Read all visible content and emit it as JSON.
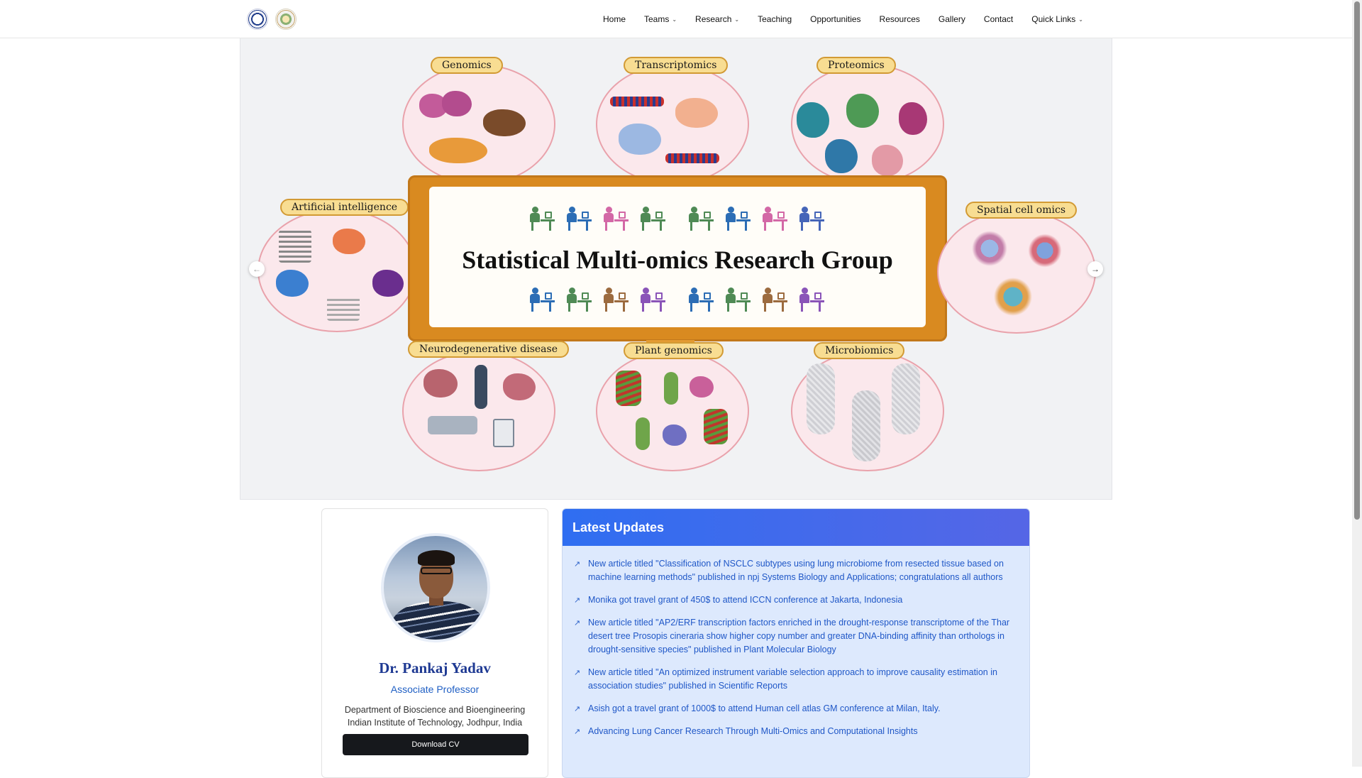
{
  "nav": {
    "items": [
      {
        "label": "Home",
        "dropdown": false
      },
      {
        "label": "Teams",
        "dropdown": true
      },
      {
        "label": "Research",
        "dropdown": true
      },
      {
        "label": "Teaching",
        "dropdown": false
      },
      {
        "label": "Opportunities",
        "dropdown": false
      },
      {
        "label": "Resources",
        "dropdown": false
      },
      {
        "label": "Gallery",
        "dropdown": false
      },
      {
        "label": "Contact",
        "dropdown": false
      },
      {
        "label": "Quick Links",
        "dropdown": true
      }
    ]
  },
  "hero": {
    "title": "Statistical Multi-omics Research Group",
    "topics": {
      "genomics": "Genomics",
      "transcriptomics": "Transcriptomics",
      "proteomics": "Proteomics",
      "ai": "Artificial intelligence",
      "spatial": "Spatial cell omics",
      "neuro": "Neurodegenerative disease",
      "plant": "Plant genomics",
      "microbiomics": "Microbiomics"
    },
    "worker_colors_top": [
      "#4f8a55",
      "#2c6db5",
      "#d368a6",
      "#4f8a55",
      "#4f8a55",
      "#2c6db5",
      "#d368a6",
      "#4565b8"
    ],
    "worker_colors_bottom": [
      "#2c6db5",
      "#4f8a55",
      "#9c6b3f",
      "#8a54b8",
      "#2c6db5",
      "#4f8a55",
      "#9c6b3f",
      "#8a54b8"
    ]
  },
  "profile": {
    "name": "Dr. Pankaj Yadav",
    "role": "Associate Professor",
    "department": "Department of Bioscience and Bioengineering",
    "institute": "Indian Institute of Technology, Jodhpur, India",
    "cv_label": "Download CV"
  },
  "updates": {
    "heading": "Latest Updates",
    "items": [
      "New article titled \"Classification of NSCLC subtypes using lung microbiome from resected tissue based on machine learning methods\" published in npj Systems Biology and Applications; congratulations all authors",
      "Monika got travel grant of 450$ to attend ICCN conference at Jakarta, Indonesia",
      "New article titled \"AP2/ERF transcription factors enriched in the drought-response transcriptome of the Thar desert tree Prosopis cineraria show higher copy number and greater DNA-binding affinity than orthologs in drought-sensitive species\" published in Plant Molecular Biology",
      "New article titled \"An optimized instrument variable selection approach to improve causality estimation in association studies\" published in Scientific Reports",
      "Asish got a travel grant of 1000$ to attend Human cell atlas GM conference at Milan, Italy.",
      "Advancing Lung Cancer Research Through Multi-Omics and Computational Insights"
    ]
  }
}
